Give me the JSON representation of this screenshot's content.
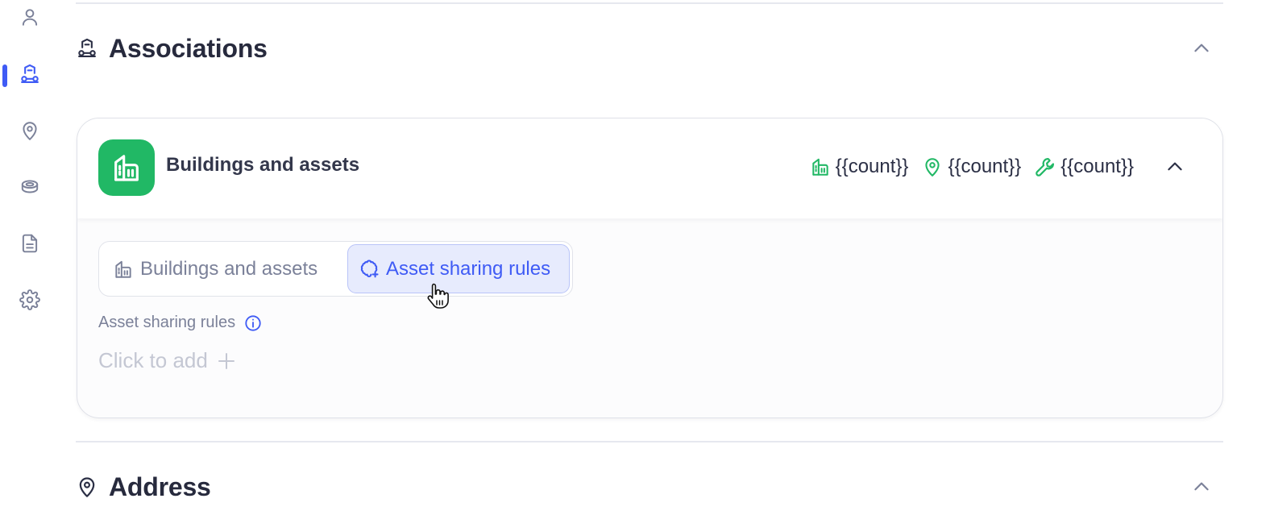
{
  "nav": {
    "items": [
      {
        "icon": "user-icon"
      },
      {
        "icon": "assets-icon",
        "active": true
      },
      {
        "icon": "location-pin-icon"
      },
      {
        "icon": "coins-icon"
      },
      {
        "icon": "document-icon"
      },
      {
        "icon": "gear-icon"
      }
    ]
  },
  "associations": {
    "title": "Associations",
    "icon": "assets-icon",
    "card": {
      "title": "Buildings and assets",
      "counts": [
        {
          "icon": "building-icon",
          "value": "{{count}}"
        },
        {
          "icon": "location-pin-icon",
          "value": "{{count}}"
        },
        {
          "icon": "wrench-icon",
          "value": "{{count}}"
        }
      ],
      "tabs": [
        {
          "label": "Buildings and assets",
          "icon": "building-icon",
          "selected": false
        },
        {
          "label": "Asset sharing rules",
          "icon": "sharing-rules-icon",
          "selected": true
        }
      ],
      "field_label": "Asset sharing rules",
      "add_label": "Click to add"
    }
  },
  "address": {
    "title": "Address",
    "icon": "location-pin-icon"
  },
  "colors": {
    "accent": "#3f5bf5",
    "brand_green": "#21b865",
    "muted_text": "#7b8199",
    "placeholder_text": "#c4c7d3"
  }
}
